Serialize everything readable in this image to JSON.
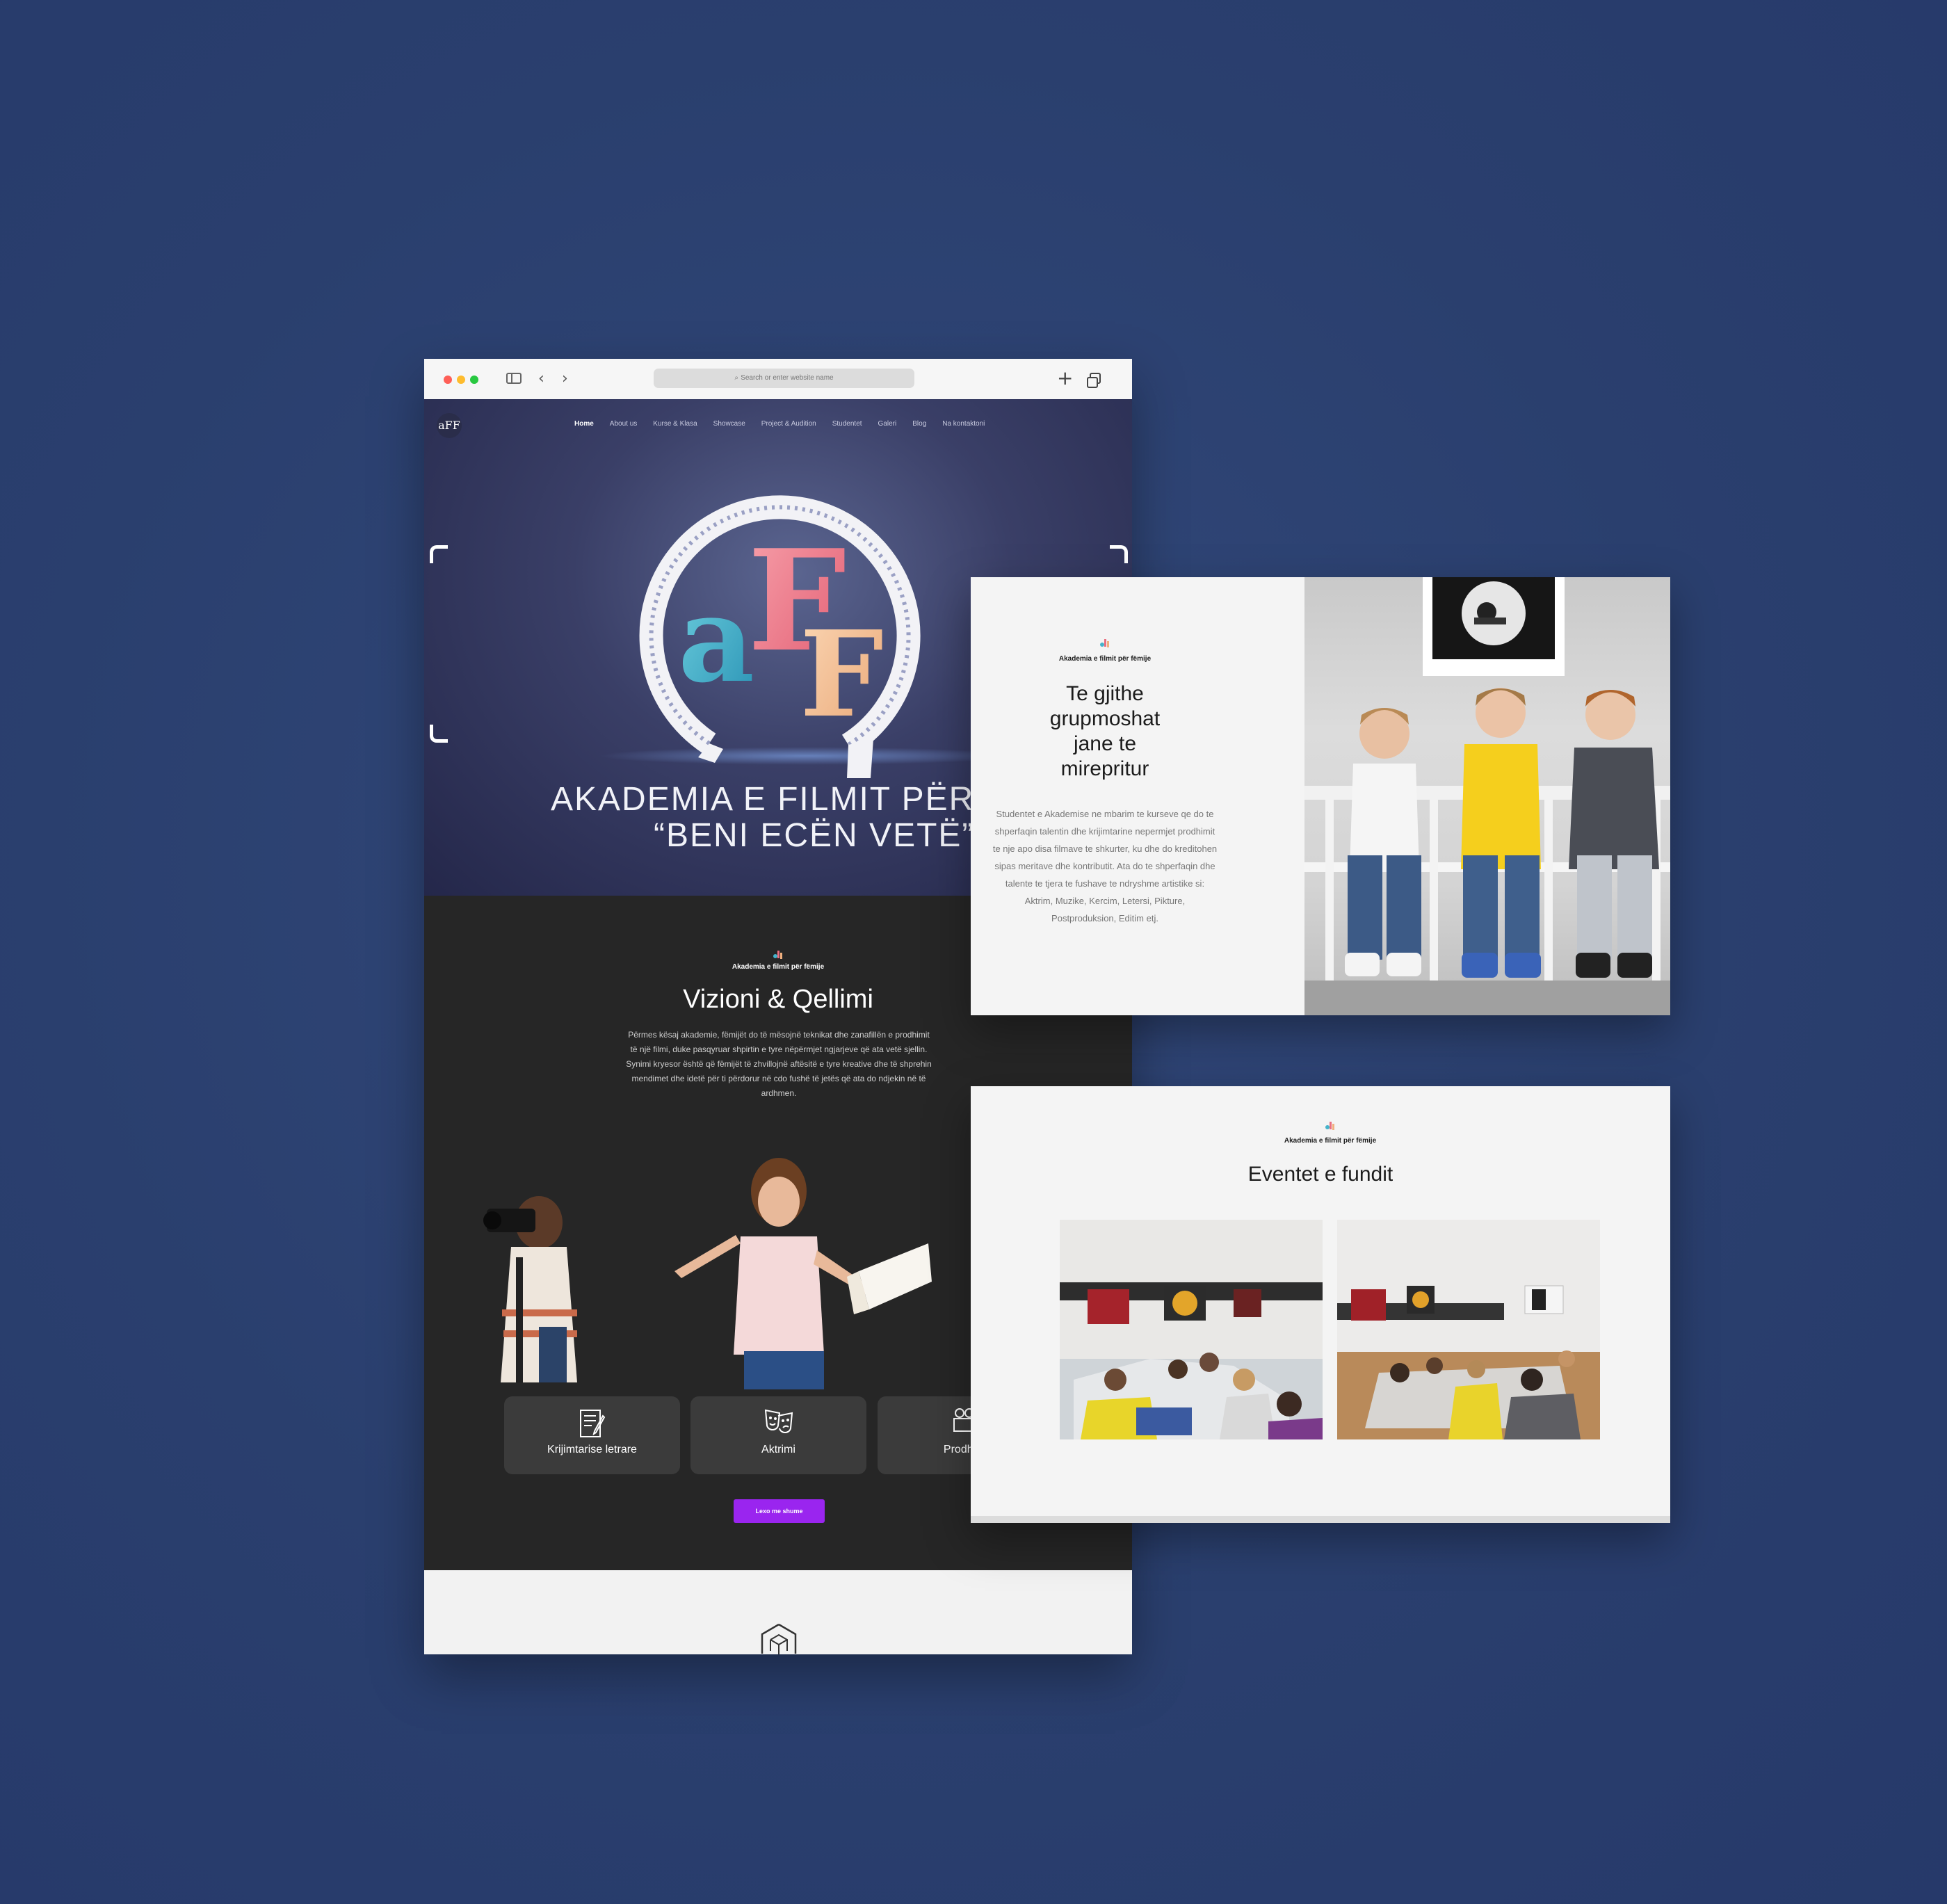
{
  "browser": {
    "url_placeholder": "Search or enter website name"
  },
  "site": {
    "logo_text": "aFF",
    "nav": [
      {
        "label": "Home",
        "active": true
      },
      {
        "label": "About us"
      },
      {
        "label": "Kurse & Klasa"
      },
      {
        "label": "Showcase"
      },
      {
        "label": "Project & Audition"
      },
      {
        "label": "Studentet"
      },
      {
        "label": "Galeri"
      },
      {
        "label": "Blog"
      },
      {
        "label": "Na kontaktoni"
      }
    ],
    "hero": {
      "title_line1": "AKADEMIA E FILMIT PËR FËM",
      "title_line2": "“BENI ECËN VETË”"
    },
    "vision": {
      "brand": "Akademia e filmit për fëmije",
      "title": "Vizioni & Qellimi",
      "text": "Përmes kësaj akademie, fëmijët do të mësojnë teknikat dhe zanafillën e prodhimit të një filmi, duke pasqyruar shpirtin e tyre nëpërmjet ngjarjeve që ata vetë sjellin. Synimi kryesor është që fëmijët të zhvillojnë aftësitë e tyre kreative dhe të shprehin mendimet dhe idetë për ti përdorur në cdo fushë të jetës që ata do ndjekin në të ardhmen.",
      "cards": [
        {
          "label": "Krijimtarise letrare",
          "icon": "writing-icon"
        },
        {
          "label": "Aktrimi",
          "icon": "theater-masks-icon"
        },
        {
          "label": "Prodhimi",
          "icon": "camera-icon"
        }
      ],
      "button": "Lexo me shume"
    }
  },
  "panel_students": {
    "brand": "Akademia e filmit për fëmije",
    "title": "Te gjithe grupmoshat jane te mirepritur",
    "text": "Studentet e Akademise ne mbarim te kurseve qe do te shperfaqin  talentin dhe krijimtarine nepermjet prodhimit te nje apo disa filmave te shkurter, ku dhe do kreditohen sipas meritave dhe kontributit. Ata do te shperfaqin dhe talente te tjera te fushave te ndryshme artistike si: Aktrim, Muzike, Kercim, Letersi, Pikture, Postproduksion, Editim etj."
  },
  "panel_events": {
    "brand": "Akademia e filmit për fëmije",
    "title": "Eventet e fundit"
  },
  "colors": {
    "background": "#2a3f6e",
    "accent_button": "#9a25ef",
    "dark_section": "#262626"
  }
}
